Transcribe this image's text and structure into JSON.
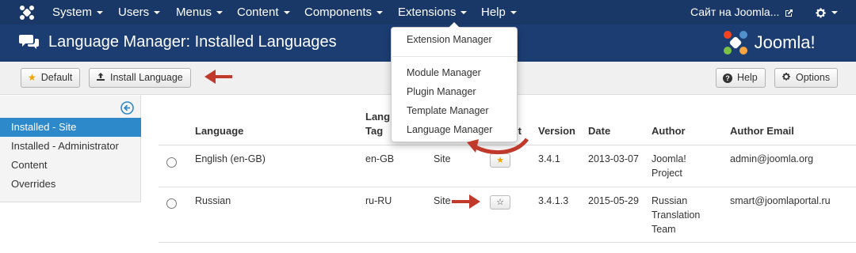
{
  "navbar": {
    "items": [
      {
        "label": "System"
      },
      {
        "label": "Users"
      },
      {
        "label": "Menus"
      },
      {
        "label": "Content"
      },
      {
        "label": "Components"
      },
      {
        "label": "Extensions"
      },
      {
        "label": "Help"
      }
    ],
    "site_link": "Сайт на Joomla...",
    "icons": [
      "joomla-logo-icon",
      "external-link-icon",
      "gear-icon"
    ]
  },
  "header": {
    "title": "Language Manager: Installed Languages",
    "brand": "Joomla!",
    "icons": [
      "comments-icon",
      "joomla-brand-icon"
    ]
  },
  "toolbar": {
    "default_label": "Default",
    "install_label": "Install Language",
    "help_label": "Help",
    "options_label": "Options",
    "icons": [
      "star-icon",
      "upload-icon",
      "question-icon",
      "gear-icon"
    ]
  },
  "sidebar": {
    "items": [
      {
        "label": "Installed - Site",
        "active": true
      },
      {
        "label": "Installed - Administrator",
        "active": false
      },
      {
        "label": "Content",
        "active": false
      },
      {
        "label": "Overrides",
        "active": false
      }
    ]
  },
  "table": {
    "headers": {
      "language": "Language",
      "tag_line1": "Lang",
      "tag_line2": "Tag",
      "client": "",
      "default": "lt",
      "version": "Version",
      "date": "Date",
      "author": "Author",
      "email": "Author Email"
    },
    "rows": [
      {
        "language": "English (en-GB)",
        "tag": "en-GB",
        "client": "Site",
        "version": "3.4.1",
        "date": "2013-03-07",
        "author_line1": "Joomla!",
        "author_line2": "Project",
        "author_line3": "",
        "email": "admin@joomla.org"
      },
      {
        "language": "Russian",
        "tag": "ru-RU",
        "client": "Site",
        "version": "3.4.1.3",
        "date": "2015-05-29",
        "author_line1": "Russian",
        "author_line2": "Translation",
        "author_line3": "Team",
        "email": "smart@joomlaportal.ru"
      }
    ]
  },
  "extensions_menu": {
    "items": [
      {
        "label": "Extension Manager"
      },
      {
        "label": "Module Manager"
      },
      {
        "label": "Plugin Manager"
      },
      {
        "label": "Template Manager"
      },
      {
        "label": "Language Manager"
      }
    ]
  },
  "colors": {
    "navbar": "#1a3867",
    "header": "#1c3d72",
    "sidebar_active": "#2d89c9",
    "annotation_arrow": "#c0392b",
    "brand_orange": "#f9a541"
  }
}
